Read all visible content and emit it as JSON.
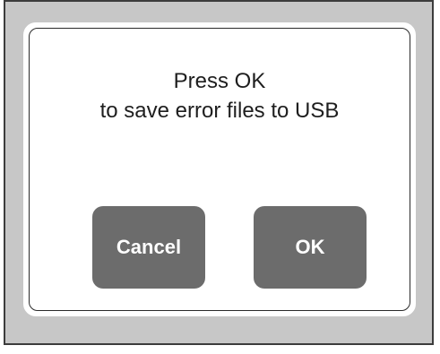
{
  "dialog": {
    "message_line1": "Press OK",
    "message_line2": "to save error files to USB",
    "cancel_label": "Cancel",
    "ok_label": "OK"
  },
  "colors": {
    "frame_background": "#c7c7c7",
    "frame_border": "#3c3c3c",
    "dialog_background": "#ffffff",
    "button_background": "#6c6c6c",
    "button_text": "#ffffff",
    "message_text": "#1e1e1e"
  }
}
